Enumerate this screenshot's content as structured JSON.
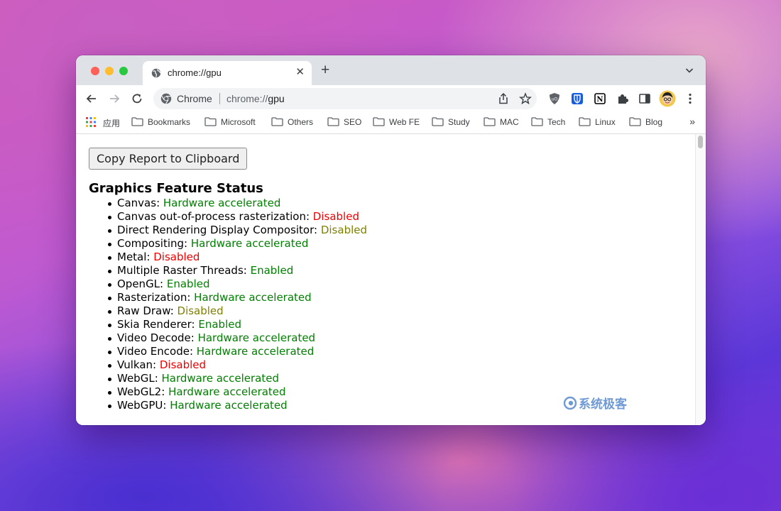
{
  "tab": {
    "title": "chrome://gpu"
  },
  "omnibox": {
    "site_label": "Chrome",
    "url_prefix": "chrome://",
    "url_host": "gpu"
  },
  "bookmarks": {
    "apps_label": "应用",
    "items": [
      "Bookmarks",
      "Microsoft",
      "Others",
      "SEO",
      "Web FE",
      "Study",
      "MAC",
      "Tech",
      "Linux",
      "Blog"
    ],
    "more": "»"
  },
  "page": {
    "copy_button": "Copy Report to Clipboard",
    "section_title": "Graphics Feature Status",
    "features": [
      {
        "name": "Canvas",
        "status": "Hardware accelerated",
        "color": "#008000"
      },
      {
        "name": "Canvas out-of-process rasterization",
        "status": "Disabled",
        "color": "#ee0000"
      },
      {
        "name": "Direct Rendering Display Compositor",
        "status": "Disabled",
        "color": "#808000"
      },
      {
        "name": "Compositing",
        "status": "Hardware accelerated",
        "color": "#008000"
      },
      {
        "name": "Metal",
        "status": "Disabled",
        "color": "#ee0000"
      },
      {
        "name": "Multiple Raster Threads",
        "status": "Enabled",
        "color": "#008000"
      },
      {
        "name": "OpenGL",
        "status": "Enabled",
        "color": "#008000"
      },
      {
        "name": "Rasterization",
        "status": "Hardware accelerated",
        "color": "#008000"
      },
      {
        "name": "Raw Draw",
        "status": "Disabled",
        "color": "#808000"
      },
      {
        "name": "Skia Renderer",
        "status": "Enabled",
        "color": "#008000"
      },
      {
        "name": "Video Decode",
        "status": "Hardware accelerated",
        "color": "#008000"
      },
      {
        "name": "Video Encode",
        "status": "Hardware accelerated",
        "color": "#008000"
      },
      {
        "name": "Vulkan",
        "status": "Disabled",
        "color": "#ee0000"
      },
      {
        "name": "WebGL",
        "status": "Hardware accelerated",
        "color": "#008000"
      },
      {
        "name": "WebGL2",
        "status": "Hardware accelerated",
        "color": "#008000"
      },
      {
        "name": "WebGPU",
        "status": "Hardware accelerated",
        "color": "#008000"
      }
    ]
  },
  "watermark": {
    "text": "系统极客"
  }
}
